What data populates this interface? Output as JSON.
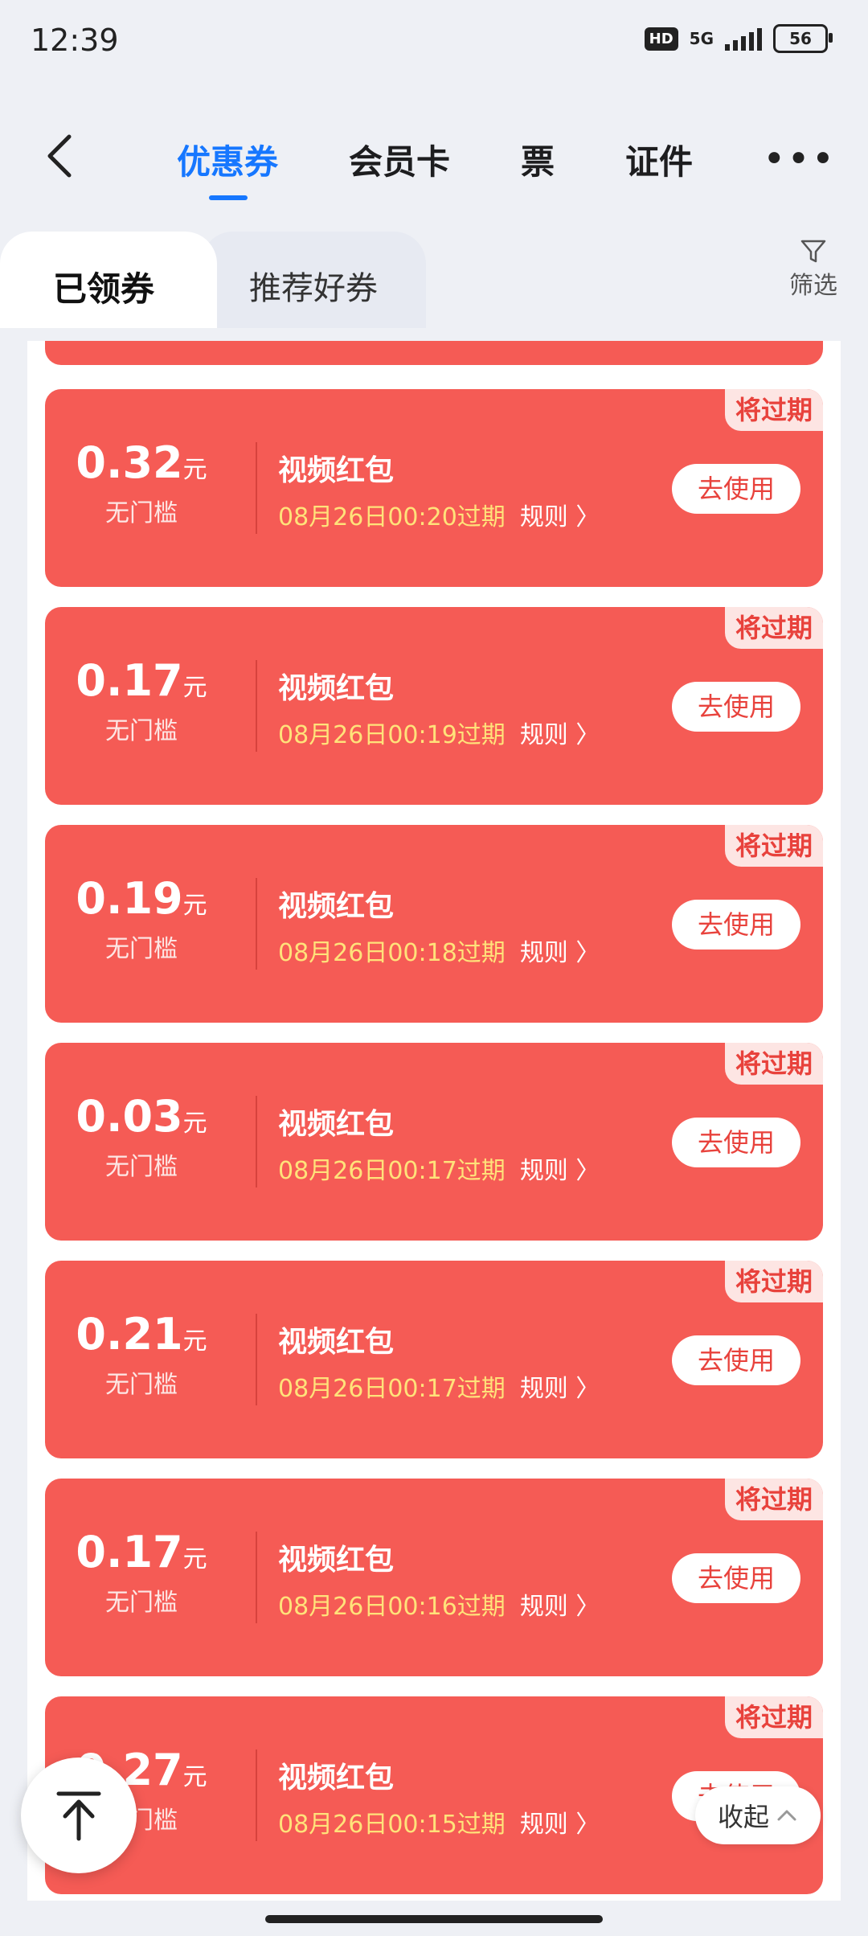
{
  "status": {
    "time": "12:39",
    "hd": "HD",
    "network": "5G",
    "battery": "56"
  },
  "nav": {
    "tabs": [
      "优惠券",
      "会员卡",
      "票",
      "证件"
    ],
    "active_tab": "优惠券",
    "more": "•••"
  },
  "subtabs": {
    "active": "已领券",
    "other": "推荐好券",
    "filter": "筛选"
  },
  "coupons": [
    {
      "amount": "0.32",
      "unit": "元",
      "condition": "无门槛",
      "title": "视频红包",
      "expire": "08月26日00:20过期",
      "rule": "规则",
      "button": "去使用",
      "tag": "将过期"
    },
    {
      "amount": "0.17",
      "unit": "元",
      "condition": "无门槛",
      "title": "视频红包",
      "expire": "08月26日00:19过期",
      "rule": "规则",
      "button": "去使用",
      "tag": "将过期"
    },
    {
      "amount": "0.19",
      "unit": "元",
      "condition": "无门槛",
      "title": "视频红包",
      "expire": "08月26日00:18过期",
      "rule": "规则",
      "button": "去使用",
      "tag": "将过期"
    },
    {
      "amount": "0.03",
      "unit": "元",
      "condition": "无门槛",
      "title": "视频红包",
      "expire": "08月26日00:17过期",
      "rule": "规则",
      "button": "去使用",
      "tag": "将过期"
    },
    {
      "amount": "0.21",
      "unit": "元",
      "condition": "无门槛",
      "title": "视频红包",
      "expire": "08月26日00:17过期",
      "rule": "规则",
      "button": "去使用",
      "tag": "将过期"
    },
    {
      "amount": "0.17",
      "unit": "元",
      "condition": "无门槛",
      "title": "视频红包",
      "expire": "08月26日00:16过期",
      "rule": "规则",
      "button": "去使用",
      "tag": "将过期"
    },
    {
      "amount": "0.27",
      "unit": "元",
      "condition": "无门槛",
      "title": "视频红包",
      "expire": "08月26日00:15过期",
      "rule": "规则",
      "button": "去使用",
      "tag": "将过期"
    }
  ],
  "floating": {
    "collapse": "收起"
  },
  "colors": {
    "accent": "#1677ff",
    "coupon_bg": "#f55b55",
    "expire_text": "#ffe27a"
  }
}
